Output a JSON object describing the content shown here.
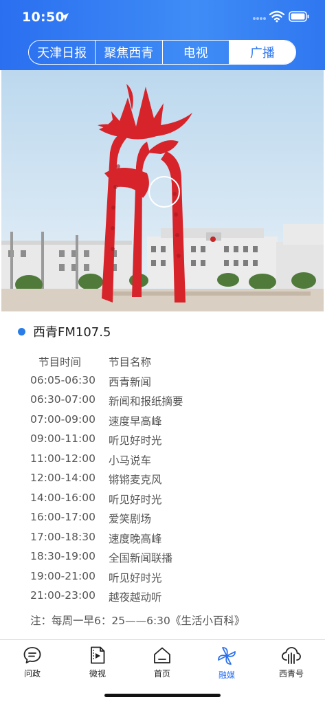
{
  "status_bar": {
    "time": "10:50"
  },
  "tabs": [
    {
      "label": "天津日报",
      "active": false
    },
    {
      "label": "聚焦西青",
      "active": false
    },
    {
      "label": "电视",
      "active": false
    },
    {
      "label": "广播",
      "active": true
    }
  ],
  "hero": {
    "icon": "play-circle-icon"
  },
  "station": {
    "name": "西青FM107.5"
  },
  "schedule": {
    "header_time": "节目时间",
    "header_name": "节目名称",
    "rows": [
      {
        "time": "06:05-06:30",
        "name": "西青新闻"
      },
      {
        "time": "06:30-07:00",
        "name": "新闻和报纸摘要"
      },
      {
        "time": "07:00-09:00",
        "name": "速度早高峰"
      },
      {
        "time": "09:00-11:00",
        "name": "听见好时光"
      },
      {
        "time": "11:00-12:00",
        "name": "小马说车"
      },
      {
        "time": "12:00-14:00",
        "name": "锵锵麦克风"
      },
      {
        "time": "14:00-16:00",
        "name": "听见好时光"
      },
      {
        "time": "16:00-17:00",
        "name": "爱笑剧场"
      },
      {
        "time": "17:00-18:30",
        "name": "速度晚高峰"
      },
      {
        "time": "18:30-19:00",
        "name": "全国新闻联播"
      },
      {
        "time": "19:00-21:00",
        "name": "听见好时光"
      },
      {
        "time": "21:00-23:00",
        "name": "越夜越动听"
      }
    ],
    "note": "注：每周一早6：25——6:30《生活小百科》"
  },
  "bottom_nav": [
    {
      "label": "问政",
      "icon": "chat-icon",
      "active": false
    },
    {
      "label": "微视",
      "icon": "video-file-icon",
      "active": false
    },
    {
      "label": "首页",
      "icon": "home-icon",
      "active": false
    },
    {
      "label": "融媒",
      "icon": "pinwheel-icon",
      "active": true
    },
    {
      "label": "西青号",
      "icon": "cloud-icon",
      "active": false
    }
  ],
  "colors": {
    "brand_blue": "#2f77f0",
    "dot_blue": "#2a7de8",
    "sculpture_red": "#d7232a"
  }
}
